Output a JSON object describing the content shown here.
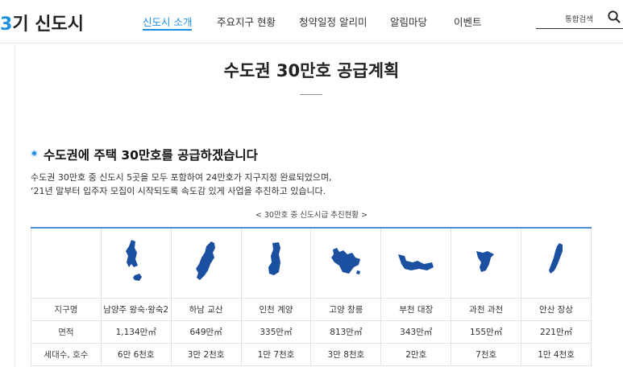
{
  "header": {
    "logo_num": "3",
    "logo_rest": "기 신도시",
    "nav": [
      {
        "label": "신도시 소개",
        "active": true
      },
      {
        "label": "주요지구 현황",
        "active": false
      },
      {
        "label": "청약일정 알리미",
        "active": false
      },
      {
        "label": "알림마당",
        "active": false
      },
      {
        "label": "이벤트",
        "active": false
      }
    ],
    "search_label": "통합검색"
  },
  "main": {
    "title": "수도권 30만호 공급계획",
    "section_title": "수도권에 주택 30만호를 공급하겠습니다",
    "desc_line1": "수도권 30만호 중 신도시 5곳을 모두 포함하여 24만호가 지구지정 완료되었으며,",
    "desc_line2": "‘21년 말부터 입주자 모집이 시작되도록 속도감 있게 사업을 추진하고 있습니다.",
    "caption": "< 30만호 중 신도시급 추진현황 >"
  },
  "table": {
    "row_labels": [
      "지구명",
      "면적",
      "세대수, 호수"
    ],
    "districts": [
      {
        "name": "남양주 왕숙·왕숙2",
        "area": "1,134만㎡",
        "units": "6만 6천호",
        "map_icon": "namyangju-map-icon"
      },
      {
        "name": "하남 교산",
        "area": "649만㎡",
        "units": "3만 2천호",
        "map_icon": "hanam-map-icon"
      },
      {
        "name": "인천 계양",
        "area": "335만㎡",
        "units": "1만 7천호",
        "map_icon": "incheon-map-icon"
      },
      {
        "name": "고양 창릉",
        "area": "813만㎡",
        "units": "3만 8천호",
        "map_icon": "goyang-map-icon"
      },
      {
        "name": "부천 대장",
        "area": "343만㎡",
        "units": "2만호",
        "map_icon": "bucheon-map-icon"
      },
      {
        "name": "과천 과천",
        "area": "155만㎡",
        "units": "7천호",
        "map_icon": "gwacheon-map-icon"
      },
      {
        "name": "안산 장상",
        "area": "221만㎡",
        "units": "1만 4천호",
        "map_icon": "ansan-map-icon"
      }
    ]
  },
  "colors": {
    "accent": "#1d8fe0",
    "map_fill": "#1b4fa0",
    "table_top_border": "#4a8ed6"
  }
}
